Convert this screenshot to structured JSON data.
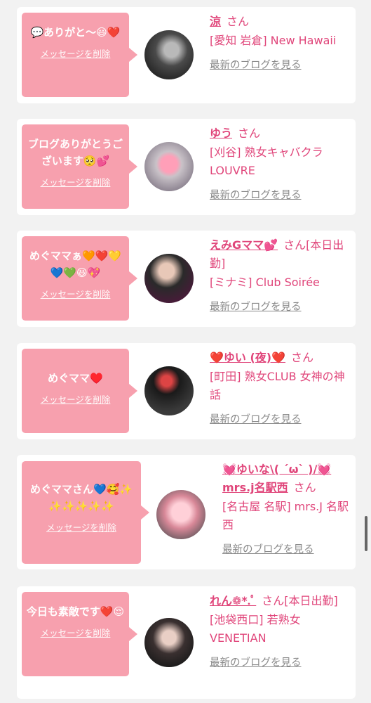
{
  "delete_label": "メッセージを削除",
  "blog_label": "最新のブログを見る",
  "items": [
    {
      "message": "💬ありがと〜😃❤️",
      "name": "涼",
      "san": "さん",
      "shop": "[愛知 岩倉] New Hawaii"
    },
    {
      "message": "ブログありがとうございます🥺💕",
      "name": "ゆう",
      "san": "さん",
      "shop": "[刈谷] 熟女キャバクラ LOUVRE"
    },
    {
      "message": "めぐママぁ🧡❤️💛💙💚😆💖",
      "name": "えみGママ💕",
      "san": "さん[本日出勤]",
      "shop": "[ミナミ] Club Soirée"
    },
    {
      "message": "めぐママ♥️",
      "name": "❤️ゆい (夜)❤️",
      "san": "さん",
      "shop": "[町田] 熟女CLUB 女神の神話"
    },
    {
      "message": "めぐママさん💙🥰✨✨✨✨✨✨",
      "name": "💓ゆいな\\( ´ω` )/💓mrs.j名駅西",
      "san": "さん",
      "shop": "[名古屋 名駅] mrs.J 名駅西"
    },
    {
      "message": "今日も素敵です❤️😌",
      "name": "れん❁*.ﾟ",
      "san": "さん[本日出勤]",
      "shop": "[池袋西口] 若熟女 VENETIAN"
    }
  ],
  "colors": {
    "bubble": "#f7a0ae",
    "accent": "#e0457a",
    "link_gray": "#8a8a8a",
    "background": "#f2f2f2"
  }
}
